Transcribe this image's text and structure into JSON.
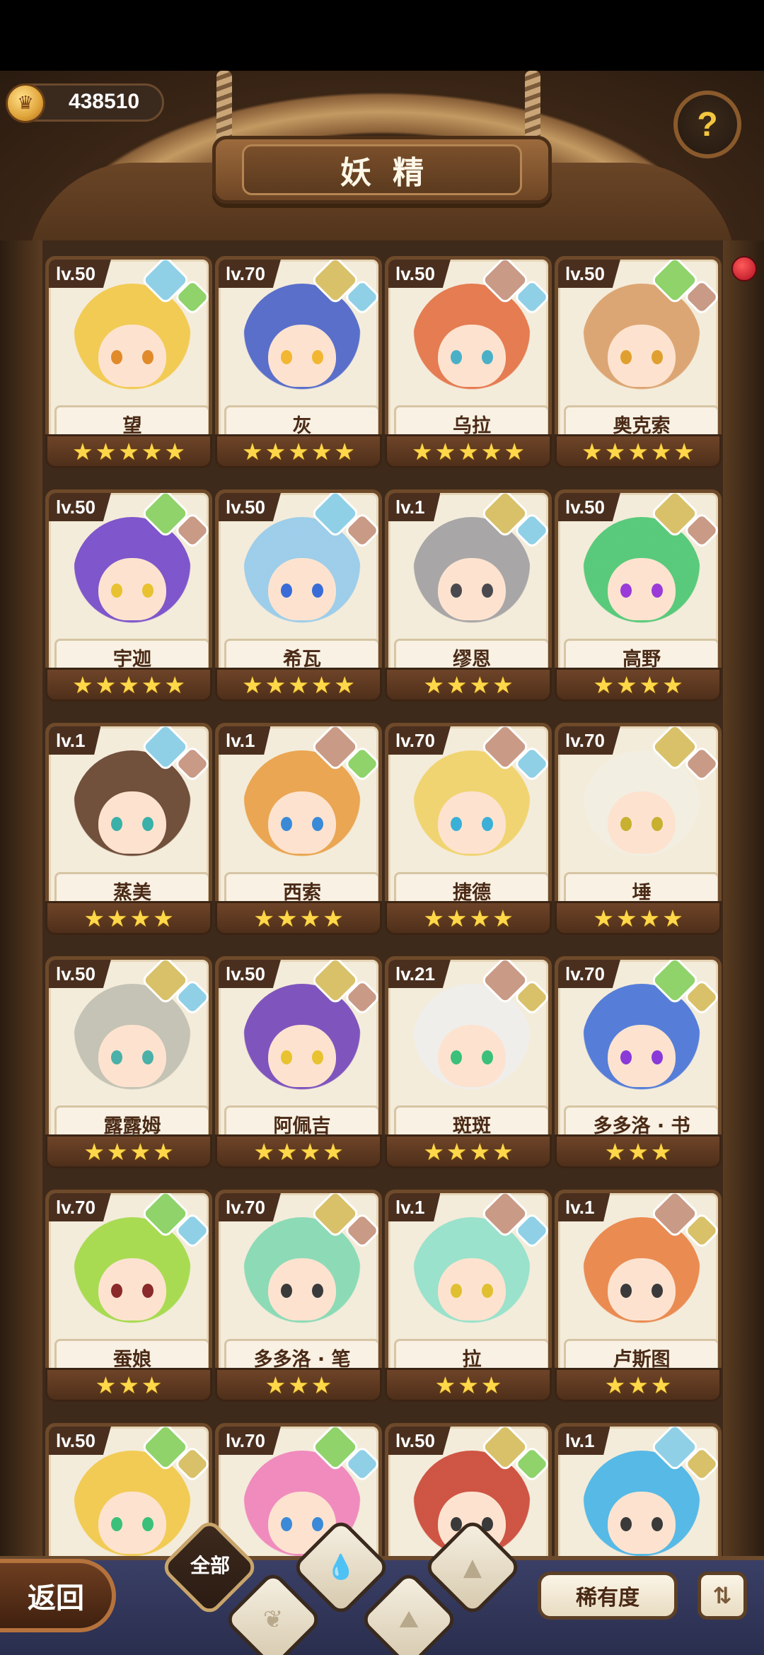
{
  "header": {
    "coins": "438510",
    "title": "妖精",
    "help_icon": "question-sprout-icon"
  },
  "colors": {
    "water": "#8fd0e6",
    "earth": "#d9c16a",
    "fire": "#c99a86",
    "wood": "#8fd36a",
    "star": "#ffd84a"
  },
  "fairies": [
    {
      "level": "lv.50",
      "name": "望",
      "stars": 5,
      "elements": [
        "water",
        "wood"
      ],
      "hair": "#f2c53d",
      "eye": "#e08a2a"
    },
    {
      "level": "lv.70",
      "name": "灰",
      "stars": 5,
      "elements": [
        "earth",
        "water"
      ],
      "hair": "#3f59c7",
      "eye": "#f2b632"
    },
    {
      "level": "lv.50",
      "name": "乌拉",
      "stars": 5,
      "elements": [
        "fire",
        "water"
      ],
      "hair": "#e2683a",
      "eye": "#4ab0c8"
    },
    {
      "level": "lv.50",
      "name": "奥克索",
      "stars": 5,
      "elements": [
        "wood",
        "fire"
      ],
      "hair": "#d89a62",
      "eye": "#e0a030"
    },
    {
      "level": "lv.50",
      "name": "宇迦",
      "stars": 5,
      "elements": [
        "wood",
        "fire"
      ],
      "hair": "#6a3cc8",
      "eye": "#e8c230"
    },
    {
      "level": "lv.50",
      "name": "希瓦",
      "stars": 5,
      "elements": [
        "water",
        "fire"
      ],
      "hair": "#8ec8ec",
      "eye": "#3a6cd8"
    },
    {
      "level": "lv.1",
      "name": "缪恩",
      "stars": 4,
      "elements": [
        "earth",
        "water"
      ],
      "hair": "#9a9a9e",
      "eye": "#4a4a4e"
    },
    {
      "level": "lv.50",
      "name": "高野",
      "stars": 4,
      "elements": [
        "earth",
        "fire"
      ],
      "hair": "#3ec46a",
      "eye": "#9a3ad8"
    },
    {
      "level": "lv.1",
      "name": "蒸美",
      "stars": 4,
      "elements": [
        "water",
        "fire"
      ],
      "hair": "#5a3420",
      "eye": "#3ab0a8"
    },
    {
      "level": "lv.1",
      "name": "西索",
      "stars": 4,
      "elements": [
        "fire",
        "wood"
      ],
      "hair": "#e89a3a",
      "eye": "#3a8ad8"
    },
    {
      "level": "lv.70",
      "name": "捷德",
      "stars": 4,
      "elements": [
        "fire",
        "water"
      ],
      "hair": "#f0d060",
      "eye": "#3ab0d8"
    },
    {
      "level": "lv.70",
      "name": "埵",
      "stars": 4,
      "elements": [
        "earth",
        "fire"
      ],
      "hair": "#f2efe2",
      "eye": "#c8b030"
    },
    {
      "level": "lv.50",
      "name": "露露姆",
      "stars": 4,
      "elements": [
        "earth",
        "water"
      ],
      "hair": "#bcbcae",
      "eye": "#4ab0a8"
    },
    {
      "level": "lv.50",
      "name": "阿佩吉",
      "stars": 4,
      "elements": [
        "earth",
        "fire"
      ],
      "hair": "#6a3ab8",
      "eye": "#e8c230"
    },
    {
      "level": "lv.21",
      "name": "斑斑",
      "stars": 4,
      "elements": [
        "fire",
        "earth"
      ],
      "hair": "#eeeeee",
      "eye": "#3ac07a"
    },
    {
      "level": "lv.70",
      "name": "多多洛 · 书",
      "stars": 3,
      "elements": [
        "wood",
        "earth"
      ],
      "hair": "#3a6ad8",
      "eye": "#8a3ad8"
    },
    {
      "level": "lv.70",
      "name": "蚕娘",
      "stars": 3,
      "elements": [
        "wood",
        "water"
      ],
      "hair": "#9ad83a",
      "eye": "#8a2a2a"
    },
    {
      "level": "lv.70",
      "name": "多多洛 · 笔",
      "stars": 3,
      "elements": [
        "earth",
        "fire"
      ],
      "hair": "#7ad8b0",
      "eye": "#3a3a3a"
    },
    {
      "level": "lv.1",
      "name": "拉",
      "stars": 3,
      "elements": [
        "fire",
        "water"
      ],
      "hair": "#8ae0c8",
      "eye": "#e0c030"
    },
    {
      "level": "lv.1",
      "name": "卢斯图",
      "stars": 3,
      "elements": [
        "fire",
        "earth"
      ],
      "hair": "#e87a3a",
      "eye": "#3a3a3a"
    },
    {
      "level": "lv.50",
      "name": "",
      "stars": 0,
      "elements": [
        "wood",
        "earth"
      ],
      "hair": "#f2c53d",
      "eye": "#3ac07a"
    },
    {
      "level": "lv.70",
      "name": "",
      "stars": 0,
      "elements": [
        "wood",
        "water"
      ],
      "hair": "#f07ab8",
      "eye": "#3a8ad8"
    },
    {
      "level": "lv.50",
      "name": "",
      "stars": 0,
      "elements": [
        "earth",
        "wood"
      ],
      "hair": "#c83a2a",
      "eye": "#3a3a3a"
    },
    {
      "level": "lv.1",
      "name": "",
      "stars": 0,
      "elements": [
        "water",
        "earth"
      ],
      "hair": "#3ab0e8",
      "eye": "#3a3a3a"
    }
  ],
  "bottom": {
    "back_label": "返回",
    "filter_all_label": "全部",
    "filters": [
      "all",
      "water-icon",
      "wood-icon",
      "fire-icon",
      "earth-icon"
    ],
    "rarity_label": "稀有度",
    "sort_icon": "sort-icon"
  }
}
